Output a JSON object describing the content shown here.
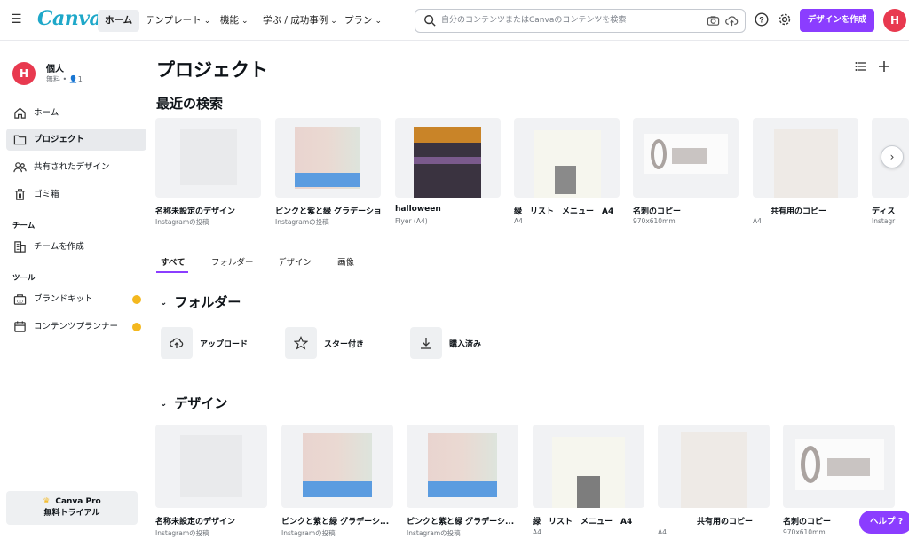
{
  "app": {
    "name": "Canva"
  },
  "nav": {
    "home": "ホーム",
    "templates": "テンプレート",
    "features": "機能",
    "learn": "学ぶ / 成功事例",
    "plans": "プラン"
  },
  "search": {
    "placeholder": "自分のコンテンツまたはCanvaのコンテンツを検索"
  },
  "header_actions": {
    "create_label": "デザインを作成",
    "avatar_initial": "H"
  },
  "user": {
    "initial": "H",
    "name": "個人",
    "meta": "無料 • 👤1"
  },
  "sidebar": {
    "items": [
      {
        "label": "ホーム",
        "icon": "home-icon"
      },
      {
        "label": "プロジェクト",
        "icon": "folder-icon"
      },
      {
        "label": "共有されたデザイン",
        "icon": "people-icon"
      },
      {
        "label": "ゴミ箱",
        "icon": "trash-icon"
      }
    ],
    "team_heading": "チーム",
    "team_items": [
      {
        "label": "チームを作成",
        "icon": "building-icon"
      }
    ],
    "tools_heading": "ツール",
    "tools_items": [
      {
        "label": "ブランドキット",
        "icon": "brand-kit-icon"
      },
      {
        "label": "コンテンツプランナー",
        "icon": "calendar-icon"
      }
    ],
    "trial_line1": "Canva Pro",
    "trial_line2": "無料トライアル"
  },
  "main": {
    "title": "プロジェクト",
    "recent_heading": "最近の検索",
    "recent": [
      {
        "title": "名称未設定のデザイン",
        "sub": "Instagramの投稿"
      },
      {
        "title": "ピンクと紫と緑 グラデーション",
        "sub": "Instagramの投稿"
      },
      {
        "title": "halloween",
        "sub": "Flyer (A4)"
      },
      {
        "title": "緑　リスト　メニュー　A4",
        "sub": "A4"
      },
      {
        "title": "名刺のコピー",
        "sub": "970x610mm"
      },
      {
        "title": "共有用のコピー",
        "sub": "A4"
      },
      {
        "title": "ディス",
        "sub": "Instagr"
      }
    ],
    "tabs": [
      "すべて",
      "フォルダー",
      "デザイン",
      "画像"
    ],
    "folders_heading": "フォルダー",
    "folders": [
      {
        "label": "アップロード",
        "icon": "upload-cloud-icon"
      },
      {
        "label": "スター付き",
        "icon": "star-icon"
      },
      {
        "label": "購入済み",
        "icon": "download-icon"
      }
    ],
    "designs_heading": "デザイン",
    "designs": [
      {
        "title": "名称未設定のデザイン",
        "sub": "Instagramの投稿"
      },
      {
        "title": "ピンクと紫と緑 グラデーシ...",
        "sub": "Instagramの投稿"
      },
      {
        "title": "ピンクと紫と緑 グラデーシ...",
        "sub": "Instagramの投稿"
      },
      {
        "title": "緑　リスト　メニュー　A4",
        "sub": "A4"
      },
      {
        "title": "共有用のコピー",
        "sub": "A4"
      },
      {
        "title": "名刺のコピー",
        "sub": "970x610mm"
      }
    ]
  },
  "help": {
    "label": "ヘルプ ?"
  }
}
